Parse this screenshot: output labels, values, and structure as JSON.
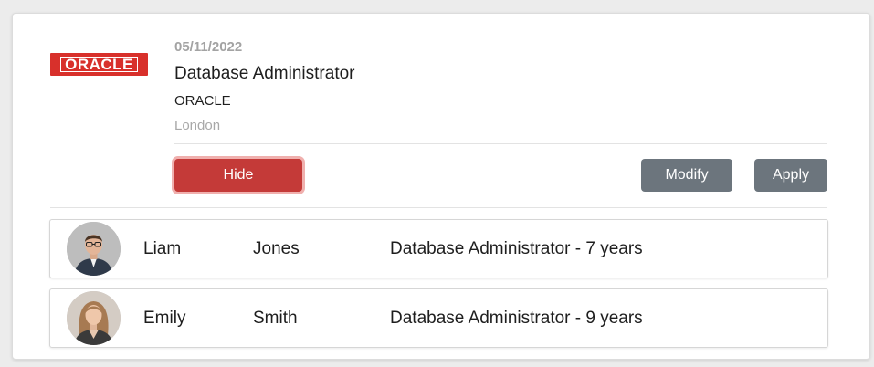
{
  "job": {
    "logo_text": "ORACLE",
    "date": "05/11/2022",
    "title": "Database Administrator",
    "company": "ORACLE",
    "location": "London"
  },
  "actions": {
    "hide_label": "Hide",
    "modify_label": "Modify",
    "apply_label": "Apply"
  },
  "candidates": [
    {
      "first_name": "Liam",
      "last_name": "Jones",
      "experience": "Database Administrator - 7 years"
    },
    {
      "first_name": "Emily",
      "last_name": "Smith",
      "experience": "Database Administrator - 9 years"
    }
  ],
  "colors": {
    "brand": "#d8302b",
    "danger": "#c43a38",
    "secondary": "#6c757d"
  }
}
